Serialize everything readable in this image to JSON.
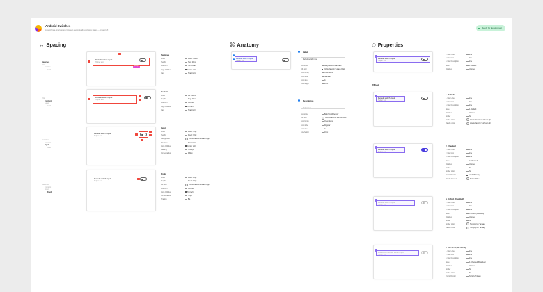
{
  "header": {
    "title": "Android Switches",
    "subtitle": "A switch is a binary toggle between two mutually exclusive states — on and off.",
    "badge": "Ready for development"
  },
  "spacing": {
    "title": "Spacing",
    "icon": "double-arrow-icon",
    "rows": [
      {
        "labels": [
          "Switches",
          "Title",
          "Subtitle",
          "Grid"
        ],
        "active": 0,
        "switch_title": "Default switch input",
        "switch_sub": "Helper text",
        "chip": "Spacing 16",
        "group": "Switches",
        "props": [
          [
            "Width",
            "Fixed: 314px"
          ],
          [
            "Height",
            "Hug: 20px"
          ],
          [
            "Direction",
            "Horizontal"
          ],
          [
            "Align Children",
            "Center Left"
          ],
          [
            "Gap",
            "Spacing 16"
          ]
        ]
      },
      {
        "labels": [
          "Title",
          "Content",
          "Label",
          "Grid"
        ],
        "active": 1,
        "switch_title": "Default switch input",
        "switch_sub": "Helper text",
        "group": "Content",
        "props": [
          [
            "Width",
            "Fill: 229px"
          ],
          [
            "Height",
            "Hug: 20px"
          ],
          [
            "Direction",
            "Vertical"
          ],
          [
            "Align Children",
            "Top Left"
          ],
          [
            "Gap",
            "Spacing 0"
          ]
        ]
      },
      {
        "labels": [
          "Switches",
          "Content",
          "Input",
          "Grid"
        ],
        "active": 2,
        "switch_title": "Default switch input",
        "switch_sub": "Helper text",
        "group": "Input",
        "props": [
          [
            "Width",
            "Fixed: 52px"
          ],
          [
            "Height",
            "Fixed: 32px"
          ],
          [
            "Background",
            "OnsSurfaceOn Surface Light"
          ],
          [
            "Direction",
            "Horizontal"
          ],
          [
            "Align Children",
            "Center Left"
          ],
          [
            "Padding",
            "Spc 8px"
          ],
          [
            "Corner radius",
            "999px"
          ]
        ]
      },
      {
        "labels": [
          "Switches",
          "Content",
          "Input",
          "Knob"
        ],
        "active": 3,
        "switch_title": "Default switch input",
        "switch_sub": "Helper text",
        "group": "Knob",
        "props": [
          [
            "Width",
            "Fixed: 16px"
          ],
          [
            "Height",
            "Fixed: 16px"
          ],
          [
            "Fill color",
            "OnsSurfaceOn Surface Light"
          ],
          [
            "Direction",
            "Vertical"
          ],
          [
            "Align Children",
            "Top Left"
          ],
          [
            "Corner radius",
            "7.5px"
          ],
          [
            "Shadow",
            "No"
          ]
        ]
      }
    ]
  },
  "anatomy": {
    "title": "Anatomy",
    "icon": "command-icon",
    "switch_title": "Default switch input",
    "switch_sub": "Helper text",
    "label_block": {
      "num": "1",
      "title": "Label",
      "value": "Default switch input",
      "props": [
        [
          "Text style",
          "BodyMedium/Standard"
        ],
        [
          "Fill color",
          "OnsSurfaceOn Surface Dark"
        ],
        [
          "Font family",
          "Open Sans"
        ],
        [
          "Font style",
          "Standard"
        ],
        [
          "Font size",
          "14"
        ],
        [
          "Line height",
          "20px"
        ]
      ]
    },
    "desc_block": {
      "num": "2",
      "title": "Description",
      "value": "Helper text",
      "props": [
        [
          "Text style",
          "BodySmall/Regular"
        ],
        [
          "Fill color",
          "OnsSurfaceOn Surface Dark"
        ],
        [
          "Font family",
          "Open Sans"
        ],
        [
          "Font style",
          "Regular"
        ],
        [
          "Font size",
          "12"
        ],
        [
          "Line height",
          "16px"
        ]
      ]
    }
  },
  "properties": {
    "title": "Properties",
    "icon": "diamond-icon",
    "state_heading": "State",
    "top": {
      "switch_title": "Default switch input",
      "switch_sub": "Helper text",
      "props": [
        [
          "1. Has Label",
          "true"
        ],
        [
          "2. Has Icon",
          "true"
        ],
        [
          "3. Has Description",
          "true"
        ],
        [
          "State",
          "1. Default"
        ],
        [
          "Disabled",
          "Unsized"
        ]
      ]
    },
    "states": [
      {
        "title": "1. Default",
        "on": false,
        "switch_title": "Default switch input",
        "switch_sub": "Helper text",
        "props": [
          [
            "1. Has Label",
            "true"
          ],
          [
            "2. Has Icon",
            "true"
          ],
          [
            "3. Has Description",
            "true"
          ],
          [
            "State",
            "1. Default"
          ],
          [
            "Disabled",
            "Unsized"
          ],
          [
            "Border",
            "No"
          ],
          [
            "Border color",
            "OnsSurfaceOn Surface Light"
          ],
          [
            "Handle color",
            "LowSurfaceOn Surface Light"
          ]
        ]
      },
      {
        "title": "2. Checked",
        "on": true,
        "switch_title": "Default switch input",
        "switch_sub": "Helper text",
        "props": [
          [
            "1. Has Label",
            "true"
          ],
          [
            "2. Has Icon",
            "true"
          ],
          [
            "3. Has Description",
            "true"
          ],
          [
            "State",
            "2. Checked"
          ],
          [
            "Disabled",
            "Unsized"
          ],
          [
            "Border",
            "No"
          ],
          [
            "Border color",
            "No"
          ],
          [
            "Track fill color",
            "CoreFilPrimary"
          ],
          [
            "Handle fill color",
            "Status/White"
          ]
        ]
      },
      {
        "title": "3. Unfold (Disabled)",
        "on": false,
        "switch_title": "Default switch input",
        "switch_sub": "Helper text",
        "props": [
          [
            "1. Has Label",
            "true"
          ],
          [
            "2. Has Icon",
            "true"
          ],
          [
            "3. Has Description",
            "true"
          ],
          [
            "State",
            "3. Unfold (Disabled)"
          ],
          [
            "Disabled",
            "Unsized"
          ],
          [
            "Border",
            "No"
          ],
          [
            "Border color",
            "Textgray/Up Yanaay"
          ],
          [
            "Handle color",
            "Textgray/Up Yanaay"
          ]
        ]
      },
      {
        "title": "4. Checked (Disabled)",
        "on": false,
        "switch_title": "Disabled checked switch input",
        "switch_sub": "Helper text",
        "props": [
          [
            "1. Has Label",
            "true"
          ],
          [
            "2. Has Icon",
            "true"
          ],
          [
            "3. Has Description",
            "true"
          ],
          [
            "State",
            "4. Checked (Disabled)"
          ],
          [
            "Disabled",
            "Unsized"
          ],
          [
            "Border",
            "No"
          ],
          [
            "Border color",
            "No"
          ],
          [
            "Track fill color",
            "Tertiary/Primary"
          ]
        ]
      }
    ]
  }
}
